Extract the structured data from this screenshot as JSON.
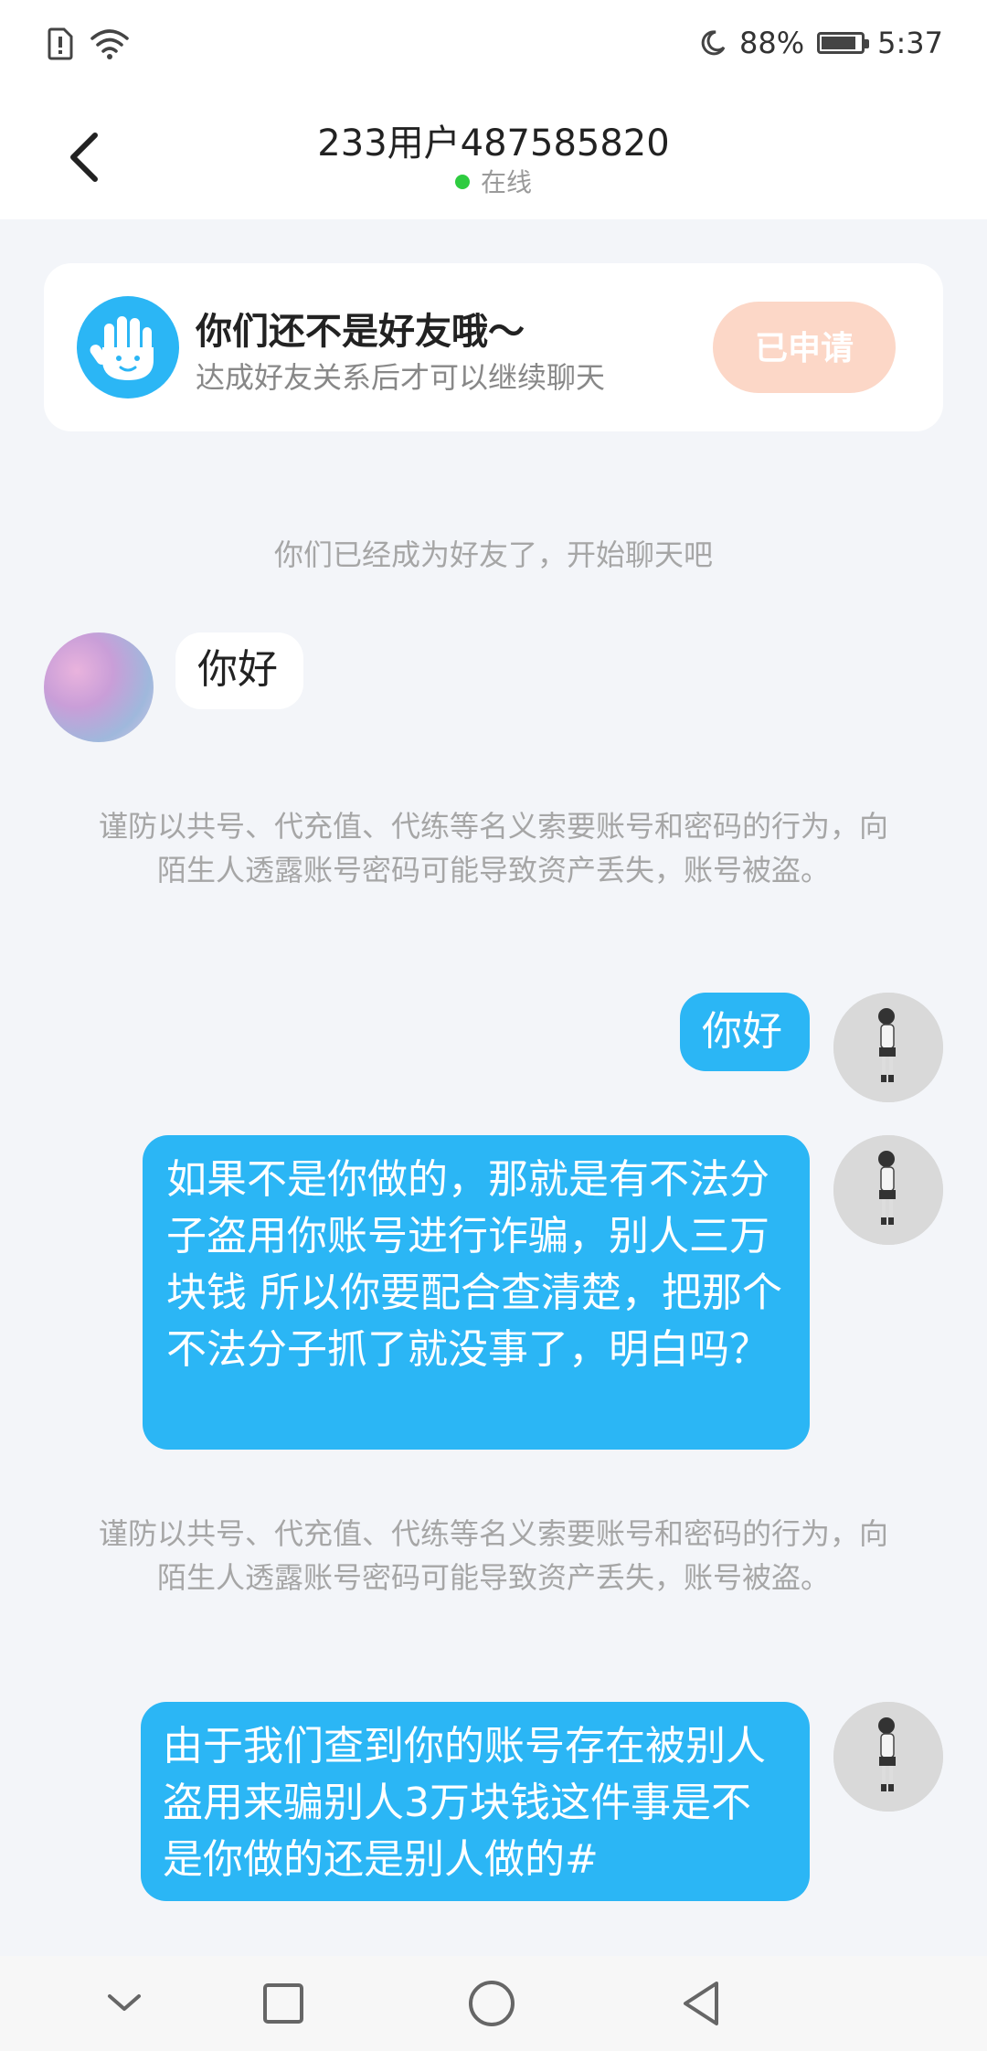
{
  "status_bar": {
    "battery": "88%",
    "time": "5:37",
    "battery_level": 0.88,
    "icons": [
      "sim-alert-icon",
      "wifi-icon",
      "moon-icon",
      "battery-icon"
    ]
  },
  "header": {
    "title": "233用户487585820",
    "status": "在线",
    "status_color": "#2ecc40"
  },
  "friend_card": {
    "title": "你们还不是好友哦～",
    "subtitle": "达成好友关系后才可以继续聊天",
    "button_label": "已申请",
    "button_color": "#fcd7c7",
    "icon_color": "#2bb6f5"
  },
  "messages": {
    "system_friend": "你们已经成为好友了，开始聊天吧",
    "peer_hello": "你好",
    "warning_1": "谨防以共号、代充值、代练等名义索要账号和密码的行为，向陌生人透露账号密码可能导致资产丢失，账号被盗。",
    "me_hello": "你好",
    "me_long_1": "如果不是你做的，那就是有不法分子盗用你账号进行诈骗，别人三万块钱 所以你要配合查清楚，把那个不法分子抓了就没事了，明白吗？",
    "warning_2": "谨防以共号、代充值、代练等名义索要账号和密码的行为，向陌生人透露账号密码可能导致资产丢失，账号被盗。",
    "me_long_2": "由于我们查到你的账号存在被别人盗用来骗别人3万块钱这件事是不是你做的还是别人做的#"
  },
  "colors": {
    "accent": "#2bb6f5",
    "background": "#f3f5f9"
  },
  "nav_bar": {
    "icons": [
      "chevron-down-icon",
      "recents-square-icon",
      "home-circle-icon",
      "back-triangle-icon"
    ]
  }
}
